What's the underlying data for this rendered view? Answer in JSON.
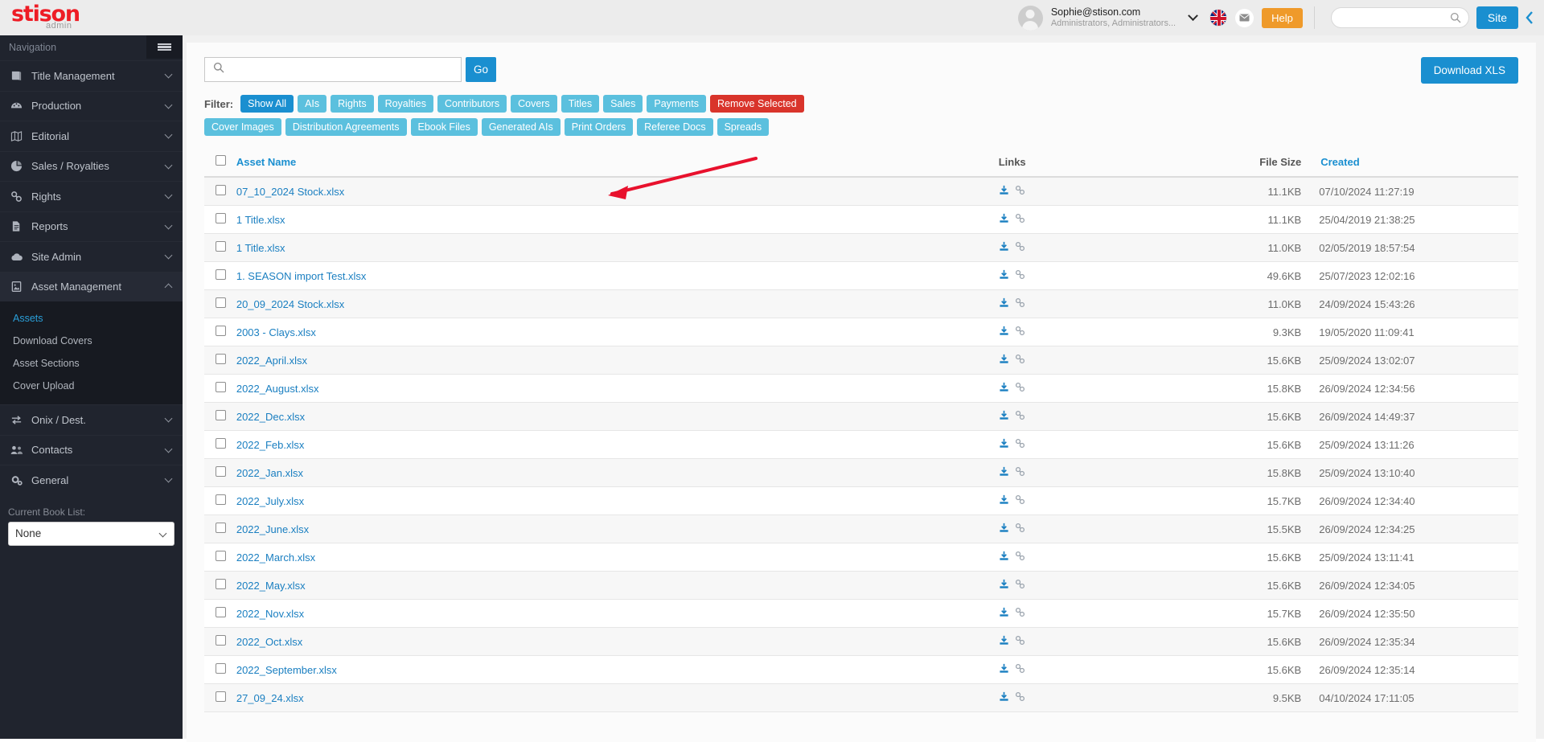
{
  "brand": {
    "name": "stison",
    "sub": "admin",
    "red": "#ee1c25"
  },
  "topbar": {
    "user_email": "Sophie@stison.com",
    "user_roles": "Administrators, Administrators...",
    "help_label": "Help",
    "site_label": "Site",
    "search_value": "",
    "search_placeholder": "",
    "icons": [
      "avatar",
      "chevron-down-icon",
      "uk-flag-icon",
      "envelope-icon",
      "search-icon",
      "chevron-left-icon"
    ]
  },
  "sidebar": {
    "title": "Navigation",
    "items": [
      {
        "label": "Title Management",
        "icon": "book-icon",
        "expanded": false
      },
      {
        "label": "Production",
        "icon": "dashboard-icon",
        "expanded": false
      },
      {
        "label": "Editorial",
        "icon": "map-icon",
        "expanded": false
      },
      {
        "label": "Sales / Royalties",
        "icon": "pie-chart-icon",
        "expanded": false
      },
      {
        "label": "Rights",
        "icon": "link-icon",
        "expanded": false
      },
      {
        "label": "Reports",
        "icon": "document-icon",
        "expanded": false
      },
      {
        "label": "Site Admin",
        "icon": "cloud-icon",
        "expanded": false
      },
      {
        "label": "Asset Management",
        "icon": "image-file-icon",
        "expanded": true
      },
      {
        "label": "Onix / Dest.",
        "icon": "exchange-icon",
        "expanded": false
      },
      {
        "label": "Contacts",
        "icon": "users-icon",
        "expanded": false
      },
      {
        "label": "General",
        "icon": "gears-icon",
        "expanded": false
      }
    ],
    "submenu": [
      {
        "label": "Assets",
        "active": true
      },
      {
        "label": "Download Covers",
        "active": false
      },
      {
        "label": "Asset Sections",
        "active": false
      },
      {
        "label": "Cover Upload",
        "active": false
      }
    ],
    "booklist_label": "Current Book List:",
    "booklist_value": "None",
    "booklist_options": [
      "None"
    ]
  },
  "main": {
    "search_value": "",
    "search_placeholder": "",
    "go_label": "Go",
    "download_xls_label": "Download XLS",
    "filter_label": "Filter:",
    "filters_row1": [
      {
        "label": "Show All",
        "style": "primary"
      },
      {
        "label": "AIs",
        "style": "default"
      },
      {
        "label": "Rights",
        "style": "default"
      },
      {
        "label": "Royalties",
        "style": "default"
      },
      {
        "label": "Contributors",
        "style": "default"
      },
      {
        "label": "Covers",
        "style": "default"
      },
      {
        "label": "Titles",
        "style": "default"
      },
      {
        "label": "Sales",
        "style": "default"
      },
      {
        "label": "Payments",
        "style": "default"
      },
      {
        "label": "Remove Selected",
        "style": "danger"
      }
    ],
    "filters_row2": [
      {
        "label": "Cover Images",
        "style": "default"
      },
      {
        "label": "Distribution Agreements",
        "style": "default"
      },
      {
        "label": "Ebook Files",
        "style": "default"
      },
      {
        "label": "Generated AIs",
        "style": "default"
      },
      {
        "label": "Print Orders",
        "style": "default"
      },
      {
        "label": "Referee Docs",
        "style": "default"
      },
      {
        "label": "Spreads",
        "style": "default"
      }
    ],
    "table": {
      "headers": {
        "asset_name": "Asset Name",
        "links": "Links",
        "file_size": "File Size",
        "created": "Created"
      },
      "rows": [
        {
          "name": "07_10_2024 Stock.xlsx",
          "size": "11.1KB",
          "created": "07/10/2024 11:27:19"
        },
        {
          "name": "1 Title.xlsx",
          "size": "11.1KB",
          "created": "25/04/2019 21:38:25"
        },
        {
          "name": "1 Title.xlsx",
          "size": "11.0KB",
          "created": "02/05/2019 18:57:54"
        },
        {
          "name": "1. SEASON import Test.xlsx",
          "size": "49.6KB",
          "created": "25/07/2023 12:02:16"
        },
        {
          "name": "20_09_2024 Stock.xlsx",
          "size": "11.0KB",
          "created": "24/09/2024 15:43:26"
        },
        {
          "name": "2003 - Clays.xlsx",
          "size": "9.3KB",
          "created": "19/05/2020 11:09:41"
        },
        {
          "name": "2022_April.xlsx",
          "size": "15.6KB",
          "created": "25/09/2024 13:02:07"
        },
        {
          "name": "2022_August.xlsx",
          "size": "15.8KB",
          "created": "26/09/2024 12:34:56"
        },
        {
          "name": "2022_Dec.xlsx",
          "size": "15.6KB",
          "created": "26/09/2024 14:49:37"
        },
        {
          "name": "2022_Feb.xlsx",
          "size": "15.6KB",
          "created": "25/09/2024 13:11:26"
        },
        {
          "name": "2022_Jan.xlsx",
          "size": "15.8KB",
          "created": "25/09/2024 13:10:40"
        },
        {
          "name": "2022_July.xlsx",
          "size": "15.7KB",
          "created": "26/09/2024 12:34:40"
        },
        {
          "name": "2022_June.xlsx",
          "size": "15.5KB",
          "created": "26/09/2024 12:34:25"
        },
        {
          "name": "2022_March.xlsx",
          "size": "15.6KB",
          "created": "25/09/2024 13:11:41"
        },
        {
          "name": "2022_May.xlsx",
          "size": "15.6KB",
          "created": "26/09/2024 12:34:05"
        },
        {
          "name": "2022_Nov.xlsx",
          "size": "15.7KB",
          "created": "26/09/2024 12:35:50"
        },
        {
          "name": "2022_Oct.xlsx",
          "size": "15.6KB",
          "created": "26/09/2024 12:35:34"
        },
        {
          "name": "2022_September.xlsx",
          "size": "15.6KB",
          "created": "26/09/2024 12:35:14"
        },
        {
          "name": "27_09_24.xlsx",
          "size": "9.5KB",
          "created": "04/10/2024 17:11:05"
        }
      ]
    }
  },
  "annotation": {
    "type": "red-arrow",
    "color": "#e8112d",
    "points_to": "row-1-links-chain-icon"
  }
}
